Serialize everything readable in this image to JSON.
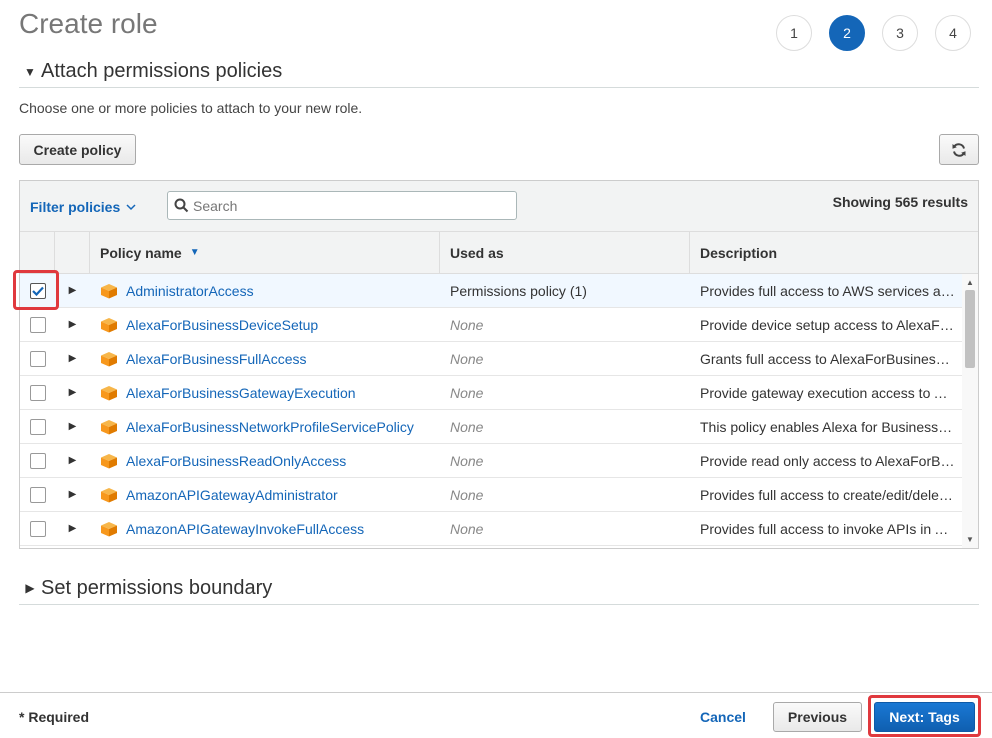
{
  "page": {
    "title": "Create role"
  },
  "steps": [
    "1",
    "2",
    "3",
    "4"
  ],
  "sections": {
    "attach": "Attach permissions policies",
    "boundary": "Set permissions boundary"
  },
  "intro": "Choose one or more policies to attach to your new role.",
  "toolbar": {
    "create_policy": "Create policy",
    "filter": "Filter policies",
    "search_placeholder": "Search",
    "showing": "Showing 565 results"
  },
  "columns": {
    "name": "Policy name",
    "used": "Used as",
    "desc": "Description"
  },
  "rows": [
    {
      "name": "AdministratorAccess",
      "used": "Permissions policy (1)",
      "desc": "Provides full access to AWS services and resources.",
      "checked": true
    },
    {
      "name": "AlexaForBusinessDeviceSetup",
      "used": "None",
      "desc": "Provide device setup access to AlexaForBusiness services",
      "checked": false
    },
    {
      "name": "AlexaForBusinessFullAccess",
      "used": "None",
      "desc": "Grants full access to AlexaForBusiness resources and access to related AWS Services",
      "checked": false
    },
    {
      "name": "AlexaForBusinessGatewayExecution",
      "used": "None",
      "desc": "Provide gateway execution access to AlexaForBusiness services",
      "checked": false
    },
    {
      "name": "AlexaForBusinessNetworkProfileServicePolicy",
      "used": "None",
      "desc": "This policy enables Alexa for Business to perform automated tasks",
      "checked": false
    },
    {
      "name": "AlexaForBusinessReadOnlyAccess",
      "used": "None",
      "desc": "Provide read only access to AlexaForBusiness services",
      "checked": false
    },
    {
      "name": "AmazonAPIGatewayAdministrator",
      "used": "None",
      "desc": "Provides full access to create/edit/delete APIs in Amazon API Gateway",
      "checked": false
    },
    {
      "name": "AmazonAPIGatewayInvokeFullAccess",
      "used": "None",
      "desc": "Provides full access to invoke APIs in Amazon API Gateway.",
      "checked": false
    }
  ],
  "footer": {
    "required": "* Required",
    "cancel": "Cancel",
    "previous": "Previous",
    "next": "Next: Tags"
  },
  "icons": {
    "checkbox": "check-icon",
    "expand": "caret-right-icon",
    "policy": "policy-cube-icon",
    "refresh": "refresh-icon",
    "search": "search-icon"
  },
  "colors": {
    "accent": "#1466b8",
    "policy_icon": "#f7981d",
    "highlight": "#e0393e"
  }
}
